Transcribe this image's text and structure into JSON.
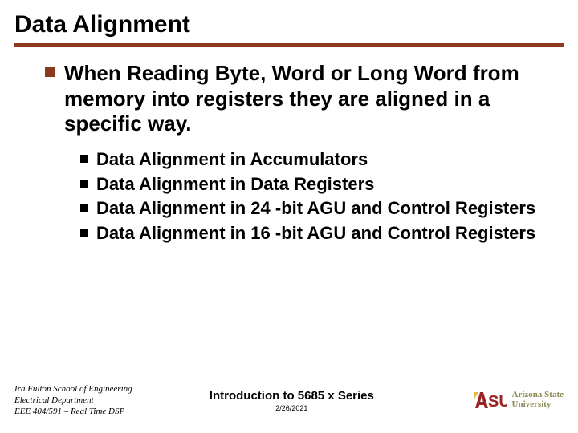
{
  "title": "Data Alignment",
  "main_bullet": "When Reading Byte, Word or Long Word from memory into registers they are aligned in a specific way.",
  "sub_bullets": [
    "Data Alignment in Accumulators",
    "Data Alignment in Data Registers",
    "Data Alignment in 24 -bit AGU and Control Registers",
    "Data Alignment in 16 -bit AGU and Control Registers"
  ],
  "footer": {
    "left_line1": "Ira Fulton School of Engineering",
    "left_line2": "Electrical Department",
    "left_line3": "EEE 404/591 – Real Time DSP",
    "center_title": "Introduction to 5685 x Series",
    "center_date": "2/26/2021",
    "logo_text": "ASU",
    "uni_line1": "Arizona State",
    "uni_line2": "University"
  }
}
